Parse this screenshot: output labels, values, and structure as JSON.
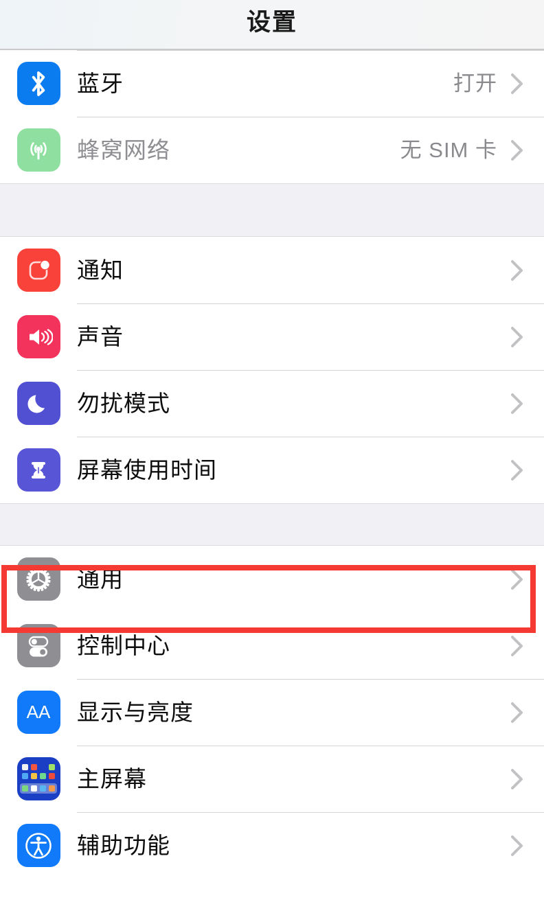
{
  "header": {
    "title": "设置"
  },
  "groups": [
    {
      "id": "connectivity",
      "rows": [
        {
          "key": "bluetooth",
          "label": "蓝牙",
          "value": "打开",
          "icon": "bluetooth-icon",
          "icon_color": "#0b7cf0",
          "dim": false
        },
        {
          "key": "cellular",
          "label": "蜂窝网络",
          "value": "无 SIM 卡",
          "icon": "cellular-antenna-icon",
          "icon_color": "#8fdfa0",
          "dim": true
        }
      ]
    },
    {
      "id": "alerts",
      "rows": [
        {
          "key": "notifications",
          "label": "通知",
          "value": "",
          "icon": "notification-badge-icon",
          "icon_color": "#f9423a",
          "dim": false
        },
        {
          "key": "sounds",
          "label": "声音",
          "value": "",
          "icon": "speaker-icon",
          "icon_color": "#f4335c",
          "dim": false
        },
        {
          "key": "do-not-disturb",
          "label": "勿扰模式",
          "value": "",
          "icon": "crescent-moon-icon",
          "icon_color": "#5150d3",
          "dim": false
        },
        {
          "key": "screen-time",
          "label": "屏幕使用时间",
          "value": "",
          "icon": "hourglass-icon",
          "icon_color": "#5856d6",
          "dim": false
        }
      ]
    },
    {
      "id": "system",
      "rows": [
        {
          "key": "general",
          "label": "通用",
          "value": "",
          "icon": "gear-icon",
          "icon_color": "#8e8e93",
          "dim": false,
          "highlighted": true
        },
        {
          "key": "control-center",
          "label": "控制中心",
          "value": "",
          "icon": "toggles-icon",
          "icon_color": "#8e8e93",
          "dim": false
        },
        {
          "key": "display-brightness",
          "label": "显示与亮度",
          "value": "",
          "icon": "aa-text-size-icon",
          "icon_color": "#107afb",
          "icon_text": "AA",
          "dim": false
        },
        {
          "key": "home-screen",
          "label": "主屏幕",
          "value": "",
          "icon": "app-grid-icon",
          "icon_color": "#1a3fc4",
          "dim": false
        },
        {
          "key": "accessibility",
          "label": "辅助功能",
          "value": "",
          "icon": "accessibility-icon",
          "icon_color": "#107afb",
          "dim": false
        }
      ]
    }
  ],
  "highlight": {
    "target": "general",
    "color": "#f43a33"
  },
  "chevron_glyph": "›"
}
